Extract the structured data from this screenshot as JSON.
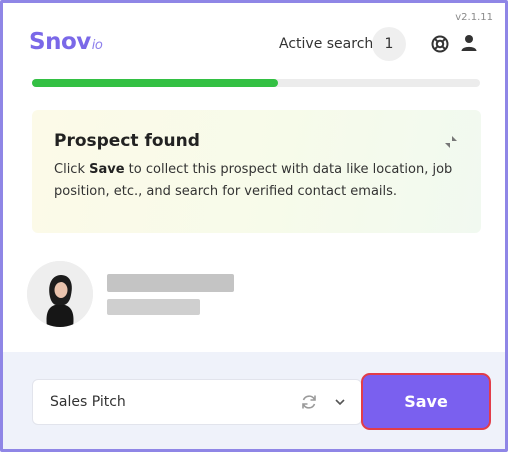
{
  "version": "v2.1.11",
  "brand": {
    "name": "Snov",
    "suffix": "io",
    "color": "#7a68e8"
  },
  "header": {
    "active_search_label": "Active search",
    "active_search_count": "1",
    "icons": [
      "lifebuoy-icon",
      "user-icon"
    ]
  },
  "progress": {
    "fraction": 0.55,
    "color": "#33c043"
  },
  "notice": {
    "title": "Prospect found",
    "text_before": "Click ",
    "text_bold": "Save",
    "text_after": " to collect this prospect with data like location, job position, etc., and search for verified contact emails.",
    "icon": "collapse-icon"
  },
  "prospect": {
    "avatar_icon": "avatar"
  },
  "footer": {
    "list_name": "Sales Pitch",
    "save_label": "Save",
    "accent_color": "#7a60ef",
    "highlight_color": "#e23d49"
  }
}
